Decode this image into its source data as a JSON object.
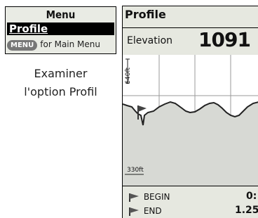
{
  "menu": {
    "title": "Menu",
    "selected_item": "Profile",
    "key_label": "MENU",
    "hint_text": "for Main Menu"
  },
  "caption": {
    "line1": "Examiner",
    "line2": "l'option Profil"
  },
  "screen": {
    "title": "Profile",
    "elevation_label": "Elevation",
    "elevation_value": "1091",
    "elevation_unit_top": "f",
    "elevation_unit_bottom": "t",
    "scale_top": "640ft",
    "scale_bottom": "330ft"
  },
  "legend": {
    "begin_label": "BEGIN",
    "begin_value": "0:",
    "end_label": "END",
    "end_value": "1.25"
  },
  "icons": [
    "flag-icon"
  ],
  "colors": {
    "screen_bg": "#e6e8e0",
    "graph_fill": "#d7d9d4",
    "grid": "#9a9a9a"
  }
}
